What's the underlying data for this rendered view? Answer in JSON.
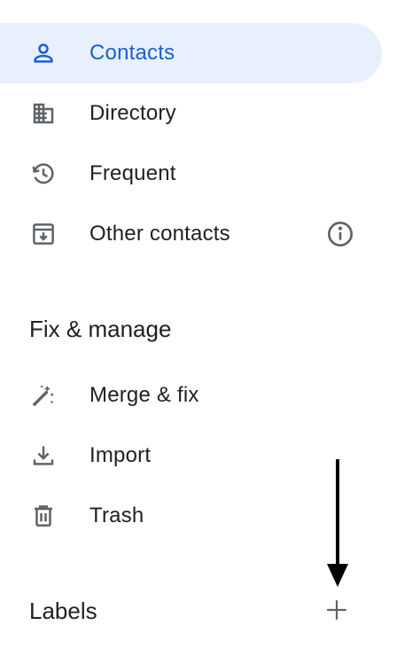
{
  "nav": {
    "contacts_label": "Contacts",
    "directory_label": "Directory",
    "frequent_label": "Frequent",
    "other_contacts_label": "Other contacts"
  },
  "fix_manage": {
    "header": "Fix & manage",
    "merge_label": "Merge & fix",
    "import_label": "Import",
    "trash_label": "Trash"
  },
  "labels_section": {
    "header": "Labels"
  },
  "colors": {
    "accent": "#1a5fd0",
    "active_bg": "#e8f0fe",
    "icon_gray": "#5f6368",
    "text": "#202124"
  },
  "icons": {
    "contacts": "person-icon",
    "directory": "building-icon",
    "frequent": "history-icon",
    "other_contacts": "archive-icon",
    "info": "info-icon",
    "merge": "magic-wand-icon",
    "import": "download-icon",
    "trash": "trash-icon",
    "add": "plus-icon"
  }
}
